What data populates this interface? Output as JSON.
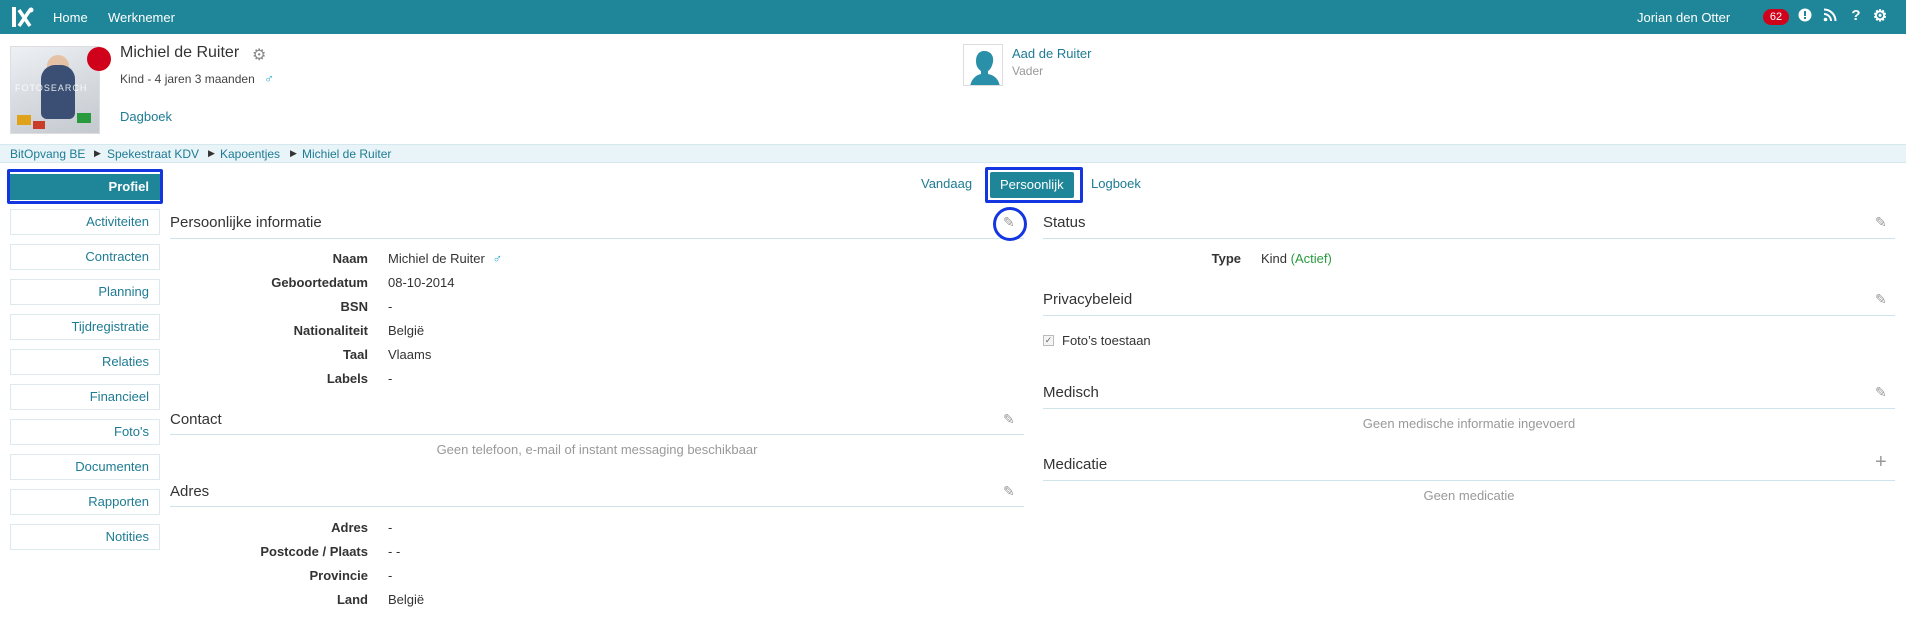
{
  "topbar": {
    "home": "Home",
    "werknemer": "Werknemer",
    "user_name": "Jorian den Otter",
    "notifications": "62",
    "icons": [
      "info-icon",
      "rss-icon",
      "help-icon",
      "gear-icon"
    ]
  },
  "child": {
    "name": "Michiel de Ruiter",
    "subtitle": "Kind - 4 jaren 3 maanden",
    "gender_symbol": "♂",
    "status_color": "#d0021b",
    "dagboek": "Dagboek",
    "photo_watermark": "FOTOSEARCH"
  },
  "parent": {
    "name": "Aad de Ruiter",
    "role": "Vader"
  },
  "breadcrumb": [
    "BitOpvang BE",
    "Spekestraat KDV",
    "Kapoentjes",
    "Michiel de Ruiter"
  ],
  "sidebar": {
    "items": [
      "Profiel",
      "Activiteiten",
      "Contracten",
      "Planning",
      "Tijdregistratie",
      "Relaties",
      "Financieel",
      "Foto's",
      "Documenten",
      "Rapporten",
      "Notities"
    ]
  },
  "tabs": {
    "vandaag": "Vandaag",
    "persoonlijk": "Persoonlijk",
    "logboek": "Logboek"
  },
  "personal": {
    "title": "Persoonlijke informatie",
    "rows": [
      {
        "label": "Naam",
        "value": "Michiel de Ruiter"
      },
      {
        "label": "Geboortedatum",
        "value": "08-10-2014"
      },
      {
        "label": "BSN",
        "value": "-"
      },
      {
        "label": "Nationaliteit",
        "value": "België"
      },
      {
        "label": "Taal",
        "value": "Vlaams"
      },
      {
        "label": "Labels",
        "value": "-"
      }
    ]
  },
  "contact": {
    "title": "Contact",
    "empty": "Geen telefoon, e-mail of instant messaging beschikbaar"
  },
  "address": {
    "title": "Adres",
    "rows": [
      {
        "label": "Adres",
        "value": "-"
      },
      {
        "label": "Postcode / Plaats",
        "value": "- -"
      },
      {
        "label": "Provincie",
        "value": "-"
      },
      {
        "label": "Land",
        "value": "België"
      }
    ]
  },
  "status": {
    "title": "Status",
    "type_label": "Type",
    "type_value": "Kind",
    "type_state": "(Actief)"
  },
  "privacy": {
    "title": "Privacybeleid",
    "photo_consent": "Foto’s toestaan",
    "photo_consent_checked": true
  },
  "medical": {
    "title": "Medisch",
    "empty": "Geen medische informatie ingevoerd"
  },
  "medication": {
    "title": "Medicatie",
    "empty": "Geen medicatie"
  },
  "colors": {
    "brand": "#1e8698",
    "link": "#1e7b93",
    "highlight": "#1436e0",
    "active_green": "#2a9a3e"
  }
}
